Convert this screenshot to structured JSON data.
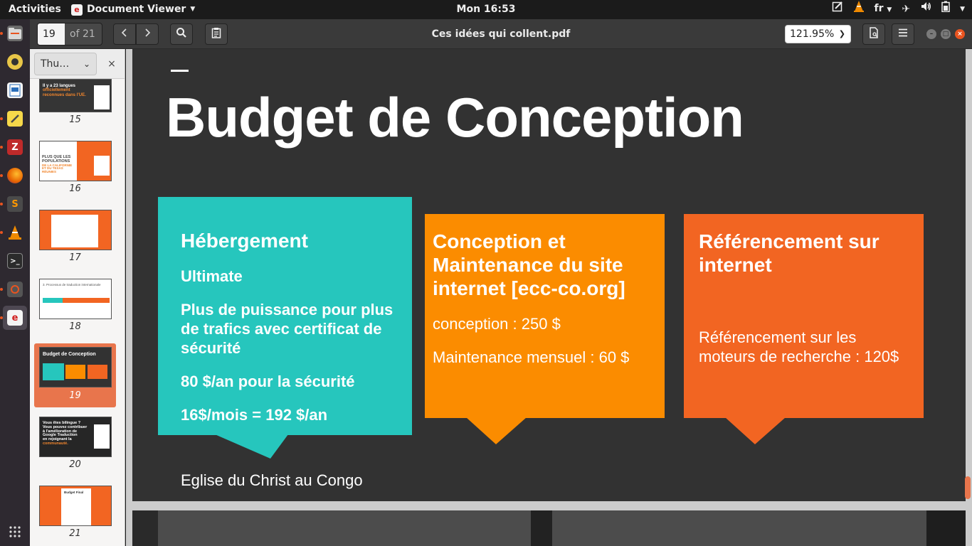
{
  "topbar": {
    "activities": "Activities",
    "app_name": "Document Viewer",
    "clock": "Mon 16:53",
    "input_lang": "fr"
  },
  "toolbar": {
    "page_number": "19",
    "page_of": "of 21",
    "document_title": "Ces idées qui collent.pdf",
    "zoom": "121.95%"
  },
  "sidebar": {
    "view_label": "Thu…",
    "thumbnails": [
      {
        "page": "15",
        "text_lines": [
          "Il y a 23 langues",
          "officiellement",
          "reconnues dans l'UE."
        ],
        "selected": false
      },
      {
        "page": "16",
        "text_lines": [
          "PLUS QUE LES",
          "POPULATIONS",
          "DE LA CALIFORNIE",
          "ET DU TEXAS RÉUNIES"
        ],
        "selected": false
      },
      {
        "page": "17",
        "text_lines": [],
        "selected": false
      },
      {
        "page": "18",
        "text_lines": [
          "3. Processus de traduction internationale"
        ],
        "selected": false
      },
      {
        "page": "19",
        "text_lines": [
          "Budget de Conception"
        ],
        "selected": true
      },
      {
        "page": "20",
        "text_lines": [
          "Vous êtes bilingue ?",
          "Vous pouvez contribuer",
          "à l'amélioration de",
          "Google Traduction",
          "en rejoignant la",
          "communauté."
        ],
        "selected": false
      },
      {
        "page": "21",
        "text_lines": [
          "Budget Final"
        ],
        "selected": false
      }
    ]
  },
  "slide": {
    "title": "Budget de Conception",
    "cards": [
      {
        "heading": "Hébergement",
        "lines": [
          "Ultimate",
          "Plus de puissance pour plus de trafics avec certificat de sécurité",
          "80 $/an pour la sécurité",
          "16$/mois = 192 $/an"
        ],
        "color": "#26c6bd"
      },
      {
        "heading": "Conception et Maintenance du site internet [ecc-co.org]",
        "lines": [
          "conception : 250 $",
          "Maintenance mensuel : 60 $"
        ],
        "color": "#fb8c00"
      },
      {
        "heading": "Référencement sur internet",
        "lines": [
          "Référencement sur les moteurs  de recherche : 120$"
        ],
        "color": "#f26522"
      }
    ],
    "footer": "Eglise du Christ au Congo"
  },
  "colors": {
    "accent": "#e8754c",
    "slide_bg": "#323232",
    "teal": "#26c6bd",
    "orange": "#fb8c00",
    "red_orange": "#f26522"
  }
}
